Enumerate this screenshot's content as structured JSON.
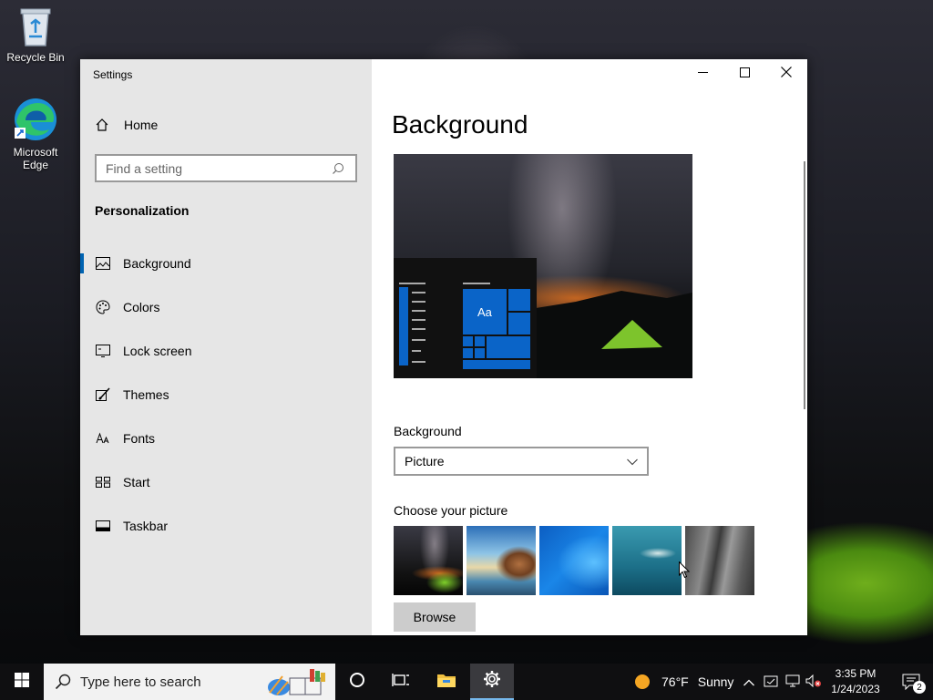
{
  "desktop": {
    "icons": [
      {
        "label": "Recycle Bin",
        "icon": "recycle-bin-icon"
      },
      {
        "label_line1": "Microsoft",
        "label_line2": "Edge",
        "icon": "edge-icon"
      }
    ]
  },
  "window": {
    "title": "Settings",
    "controls": {
      "minimize": "minimize-icon",
      "maximize": "maximize-icon",
      "close": "close-icon"
    }
  },
  "sidebar": {
    "home_label": "Home",
    "search_placeholder": "Find a setting",
    "section_title": "Personalization",
    "items": [
      {
        "label": "Background",
        "icon": "picture-icon",
        "active": true
      },
      {
        "label": "Colors",
        "icon": "palette-icon"
      },
      {
        "label": "Lock screen",
        "icon": "lock-screen-icon"
      },
      {
        "label": "Themes",
        "icon": "themes-brush-icon"
      },
      {
        "label": "Fonts",
        "icon": "fonts-icon"
      },
      {
        "label": "Start",
        "icon": "start-grid-icon"
      },
      {
        "label": "Taskbar",
        "icon": "taskbar-icon"
      }
    ]
  },
  "main": {
    "heading": "Background",
    "preview_tile_text": "Aa",
    "background_label": "Background",
    "background_value": "Picture",
    "choose_label": "Choose your picture",
    "browse_label": "Browse"
  },
  "taskbar": {
    "search_placeholder": "Type here to search",
    "weather": {
      "temp": "76°F",
      "condition": "Sunny"
    },
    "time": "3:35 PM",
    "date": "1/24/2023",
    "notification_count": "2"
  },
  "colors": {
    "accent": "#0078d7",
    "tile_blue": "#0a64c8",
    "sidebar_bg": "#e6e6e6",
    "taskbar_bg": "#101012"
  }
}
